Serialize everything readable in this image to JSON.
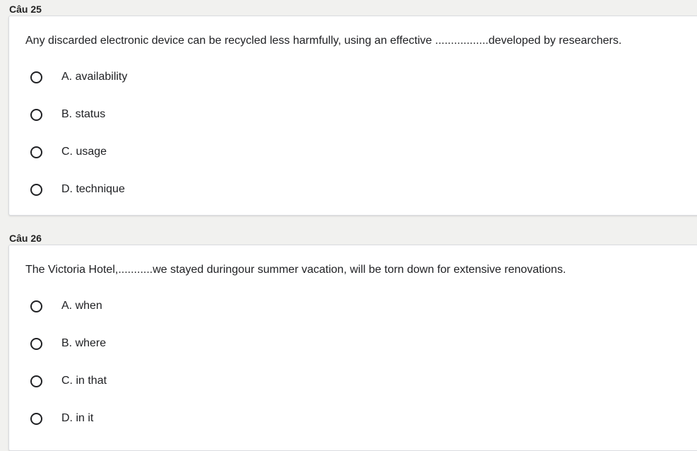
{
  "questions": [
    {
      "label": "Câu 25",
      "text": "Any discarded electronic device can be recycled less harmfully, using an effective .................developed by researchers.",
      "options": [
        "A. availability",
        "B. status",
        "C. usage",
        "D. technique"
      ]
    },
    {
      "label": "Câu 26",
      "text": "The Victoria Hotel,...........we stayed duringour summer vacation, will be torn down for extensive renovations.",
      "options": [
        "A. when",
        "B. where",
        "C. in that",
        "D. in it"
      ]
    }
  ]
}
